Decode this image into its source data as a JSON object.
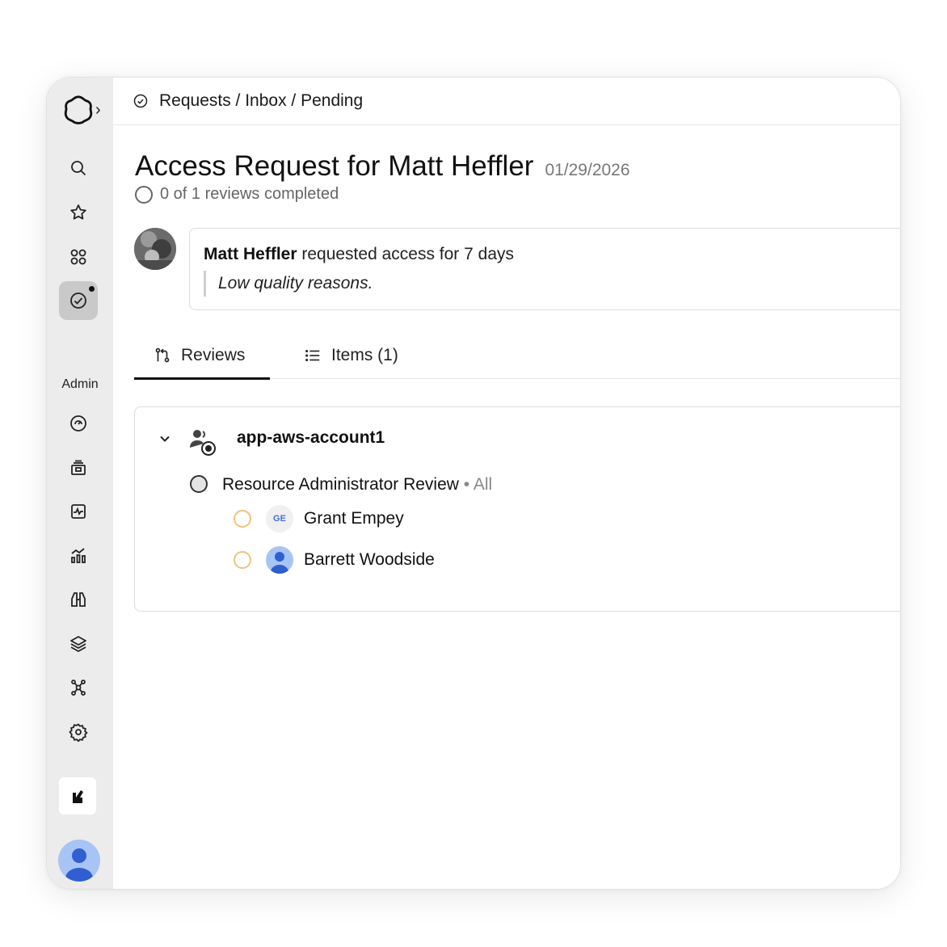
{
  "breadcrumb": "Requests / Inbox / Pending",
  "title": "Access Request for Matt Heffler",
  "date": "01/29/2026",
  "progress": "0 of 1 reviews completed",
  "request": {
    "requester": "Matt Heffler",
    "action": " requested access for 7 days",
    "reason": "Low quality reasons."
  },
  "tabs": [
    {
      "label": "Reviews",
      "icon": "git-pull-request-icon",
      "active": true
    },
    {
      "label": "Items (1)",
      "icon": "list-icon",
      "active": false
    }
  ],
  "group": {
    "name": "app-aws-account1",
    "review": {
      "name": "Resource Administrator Review",
      "meta": " • All"
    },
    "reviewers": [
      {
        "initials": "GE",
        "name": "Grant Empey"
      },
      {
        "initials": "",
        "name": "Barrett Woodside"
      }
    ]
  },
  "sidebar": {
    "admin_label": "Admin",
    "icons": [
      "search-icon",
      "star-icon",
      "apps-icon",
      "requests-icon",
      "dashboard-gauge-icon",
      "inventory-icon",
      "activity-icon",
      "analytics-icon",
      "discovery-icon",
      "layers-icon",
      "integrations-icon",
      "settings-icon"
    ]
  },
  "colors": {
    "sidebar_bg": "#ececec",
    "pending_circle": "#f0c27a",
    "avatar_blue": "#a8c4f5"
  }
}
